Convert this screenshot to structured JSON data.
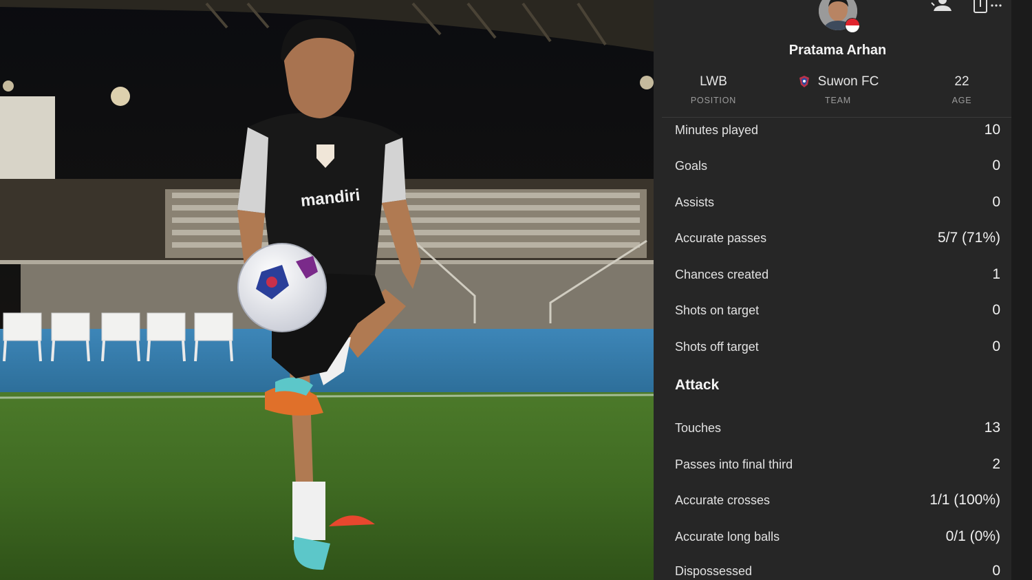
{
  "player": {
    "name": "Pratama Arhan",
    "position": "LWB",
    "position_label": "POSITION",
    "team": "Suwon FC",
    "team_label": "TEAM",
    "age": "22",
    "age_label": "AGE",
    "flag_colors": [
      "#e0242e",
      "#ffffff"
    ]
  },
  "photo": {
    "jersey_sponsor": "mandiri"
  },
  "header_icons": [
    "follow-user-icon",
    "share-icon",
    "more-icon"
  ],
  "stats": [
    {
      "label": "Minutes played",
      "value": "10"
    },
    {
      "label": "Goals",
      "value": "0"
    },
    {
      "label": "Assists",
      "value": "0"
    },
    {
      "label": "Accurate passes",
      "value": "5/7 (71%)"
    },
    {
      "label": "Chances created",
      "value": "1"
    },
    {
      "label": "Shots on target",
      "value": "0"
    },
    {
      "label": "Shots off target",
      "value": "0"
    }
  ],
  "attack": {
    "title": "Attack",
    "stats": [
      {
        "label": "Touches",
        "value": "13"
      },
      {
        "label": "Passes into final third",
        "value": "2"
      },
      {
        "label": "Accurate crosses",
        "value": "1/1 (100%)"
      },
      {
        "label": "Accurate long balls",
        "value": "0/1 (0%)"
      },
      {
        "label": "Dispossessed",
        "value": "0"
      }
    ]
  },
  "colors": {
    "panel_bg": "#262626",
    "text": "#e2e2e2",
    "muted": "#9d9d9d"
  }
}
